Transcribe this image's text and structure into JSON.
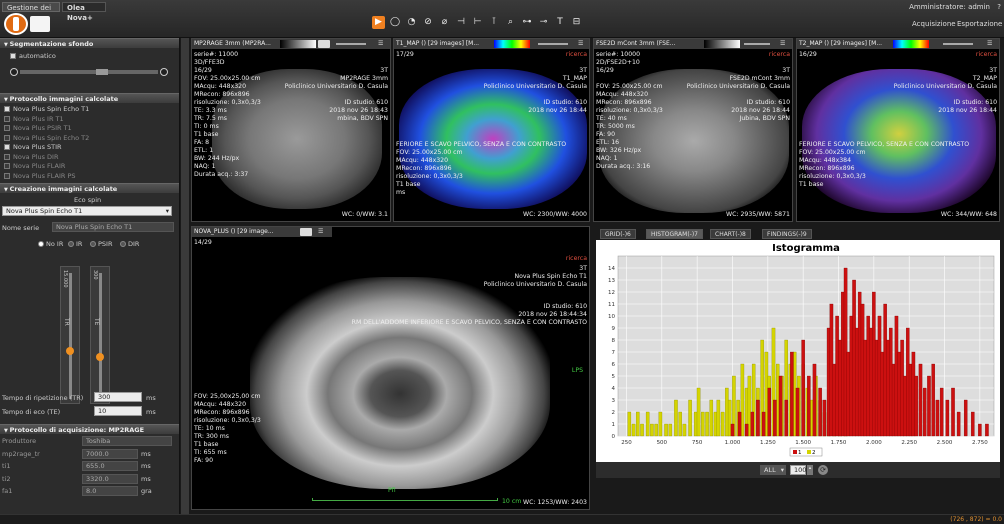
{
  "tabs": {
    "gestione": "Gestione dei dati",
    "olea": "Olea Nova+"
  },
  "top": {
    "admin": "Amministratore: admin",
    "help": "?",
    "nav": [
      "Acquisizione",
      "Esportazione"
    ]
  },
  "tools": [
    "▶",
    "◯",
    "◔",
    "⊘",
    "⌀",
    "⊣",
    "⊢",
    "⊺",
    "⌕",
    "⊶",
    "⊸",
    "T",
    "⊟"
  ],
  "left": {
    "seg_title": "Segmentazione sfondo",
    "automatico": "automatico",
    "proto_calc_title": "Protocollo immagini calcolate",
    "proto_items": [
      {
        "label": "Nova Plus Spin Echo T1",
        "checked": true
      },
      {
        "label": "Nova Plus IR T1",
        "checked": false
      },
      {
        "label": "Nova Plus PSIR T1",
        "checked": false
      },
      {
        "label": "Nova Plus Spin Echo T2",
        "checked": false
      },
      {
        "label": "Nova Plus STIR",
        "checked": true
      },
      {
        "label": "Nova Plus DIR",
        "checked": false
      },
      {
        "label": "Nova Plus FLAIR",
        "checked": false
      },
      {
        "label": "Nova Plus FLAIR PS",
        "checked": false
      }
    ],
    "creazione_title": "Creazione immagini calcolate",
    "eco_spin": "Eco spin",
    "select_value": "Nova Plus Spin Echo T1",
    "nome_serie_label": "Nome serie",
    "nome_serie_value": "Nova Plus Spin Echo T1",
    "radios": [
      "No IR",
      "IR",
      "PSIR",
      "DIR"
    ],
    "tr_label": "TR",
    "te_label": "TE",
    "tr_scale": [
      "15.000",
      "0",
      "",
      "300",
      "0"
    ],
    "tr_field_label": "Tempo di ripetizione (TR)",
    "tr_value": "300",
    "tr_unit": "ms",
    "te_field_label": "Tempo di eco (TE)",
    "te_value": "10",
    "te_unit": "ms",
    "acq_title": "Protocollo di acquisizione: MP2RAGE",
    "acq_rows": [
      {
        "label": "Produttore",
        "value": "Toshiba",
        "unit": ""
      },
      {
        "label": "mp2rage_tr",
        "value": "7000.0",
        "unit": "ms"
      },
      {
        "label": "ti1",
        "value": "655.0",
        "unit": "ms"
      },
      {
        "label": "ti2",
        "value": "3320.0",
        "unit": "ms"
      },
      {
        "label": "fa1",
        "value": "8.0",
        "unit": "gra"
      }
    ]
  },
  "vp1": {
    "title": "MP2RAGE 3mm (MP2RA...",
    "serie": "serie#: 11000",
    "seq": "3D/FFE3D",
    "slice": "16/29",
    "fov": "FOV: 25.00x25.00 cm",
    "macq": "MAcqu: 448x320",
    "mrecon": "MRecon: 896x896",
    "ris": "risoluzione: 0,3x0,3/3",
    "te": "TE: 3.3 ms",
    "tr": "TR: 7.5 ms",
    "ti": "TI: 0 ms",
    "t1": "T1 base",
    "fa": "FA: 8",
    "etl": "ETL: 1",
    "bw": "BW: 244 Hz/px",
    "naq": "NAQ: 1",
    "dur": "Durata acq.: 3:37",
    "tr_r1": "3T",
    "tr_r2": "MP2RAGE 3mm",
    "tr_r3": "Policlinico Universitario D. Casula",
    "id": "ID studio: 610",
    "date": "2018 nov 26 18:43",
    "body": "mbina, BDV SPN",
    "wc": "WC: 0/WW: 3.1"
  },
  "vp2": {
    "title": "T1_MAP () [29 images] [M...",
    "slice": "17/29",
    "ric": "ricerca",
    "r1": "3T",
    "r2": "T1_MAP",
    "r3": "Policlinico Universitario D. Casula",
    "id": "ID studio: 610",
    "date": "2018 nov 26 18:44",
    "desc": "FERIORE E SCAVO PELVICO, SENZA E CON CONTRASTO",
    "fov": "FOV: 25.00x25.00 cm",
    "macq": "MAcqu: 448x320",
    "mrecon": "MRecon: 896x896",
    "ris": "risoluzione: 0,3x0,3/3",
    "t1": "T1 base",
    "ms": "ms",
    "wc": "WC: 2300/WW: 4000",
    "ruler": "10 cm"
  },
  "vp3": {
    "title": "FSE2D mCont 3mm (FSE...",
    "serie": "serie#: 10000",
    "seq": "2D/FSE2D+10",
    "slice": "16/29",
    "ric": "ricerca",
    "r1": "3T",
    "r2": "FSE2D mCont 3mm",
    "r3": "Policlinico Universitario D. Casula",
    "id": "ID studio: 610",
    "date": "2018 nov 26 18:44",
    "fov": "FOV: 25.00x25.00 cm",
    "macq": "MAcqu: 448x320",
    "mrecon": "MRecon: 896x896",
    "ris": "risoluzione: 0,3x0,3/3",
    "te": "TE: 40 ms",
    "tr": "TR: 5000 ms",
    "fa": "FA: 90",
    "etl": "ETL: 16",
    "bw": "BW: 326 Hz/px",
    "naq": "NAQ: 1",
    "dur": "Durata acq.: 3:16",
    "body": "Jubina, BDV SPN",
    "desc": "FERIORE E SCAVO PELVICO, SENZA E CON CONTRASTO",
    "wc": "WC: 2935/WW: 5871"
  },
  "vp4": {
    "title": "T2_MAP () [29 images] [M...",
    "slice": "16/29",
    "ric": "ricerca",
    "r1": "3T",
    "r2": "T2_MAP",
    "r3": "Policlinico Universitario D. Casula",
    "id": "ID studio: 610",
    "date": "2018 nov 26 18:44",
    "desc": "FERIORE E SCAVO PELVICO, SENZA E CON CONTRASTO",
    "fov": "FOV: 25.00x25.00 cm",
    "macq": "MAcqu: 448x384",
    "mrecon": "MRecon: 896x896",
    "ris": "risoluzione: 0,3x0,3/3",
    "t1": "T1 base",
    "wc": "WC: 344/WW: 648"
  },
  "vp5": {
    "title": "NOVA_PLUS () [29 image...",
    "slice": "14/29",
    "ric": "ricerca",
    "r1": "3T",
    "r2": "Nova Plus Spin Echo T1",
    "r3": "Policlinico Universitario D. Casula",
    "id": "ID studio: 610",
    "date": "2018 nov 26 18:44:34",
    "desc": "RM DELL'ADDOME INFERIORE E SCAVO PELVICO, SENZA E CON CONTRASTO",
    "fov": "FOV: 25,00x25,00 cm",
    "macq": "MAcqu: 448x320",
    "mrecon": "MRecon: 896x896",
    "ris": "risoluzione: 0,3x0,3/3",
    "te": "TE: 10 ms",
    "tr": "TR: 300 ms",
    "t1": "T1 base",
    "ti": "TI: 655 ms",
    "fa": "FA: 90",
    "wc": "WC: 1253/WW: 2403",
    "ruler": "10 cm",
    "lps": "LPS",
    "pfi": "Pfi"
  },
  "rtabs": [
    "GRID(-)6",
    "HISTOGRAM(-)7",
    "CHART(-)8",
    "FINDINGS(-)9"
  ],
  "bottom": {
    "all": "ALL",
    "bins": "100"
  },
  "status": {
    "coords": "(726 , 872) = 0.0"
  },
  "chart_data": {
    "type": "bar",
    "title": "Istogramma",
    "xlim": [
      190,
      2850
    ],
    "ylim": [
      0,
      15
    ],
    "xticks": [
      250,
      500,
      750,
      1000,
      1250,
      1500,
      1750,
      2000,
      2250,
      2500,
      2750
    ],
    "xticklabels": [
      "250",
      "500",
      "750",
      "1.000",
      "1.250",
      "1.500",
      "1.750",
      "2.000",
      "2.250",
      "2.500",
      "2.750"
    ],
    "yticks": [
      0,
      1,
      2,
      3,
      4,
      5,
      6,
      7,
      8,
      9,
      10,
      11,
      12,
      13,
      14
    ],
    "legend": [
      "1",
      "2"
    ],
    "series": [
      {
        "color": "#d4d400",
        "x": [
          270,
          300,
          330,
          360,
          400,
          430,
          460,
          490,
          530,
          560,
          600,
          630,
          660,
          700,
          740,
          760,
          790,
          820,
          850,
          880,
          900,
          930,
          960,
          980,
          1010,
          1040,
          1070,
          1100,
          1120,
          1150,
          1180,
          1210,
          1240,
          1260,
          1290,
          1320,
          1350,
          1380,
          1410,
          1440,
          1470,
          1500,
          1530,
          1560,
          1590,
          1620,
          1650,
          1680,
          1720,
          1760,
          1800
        ],
        "values": [
          2,
          1,
          2,
          1,
          2,
          1,
          1,
          2,
          1,
          1,
          3,
          2,
          1,
          3,
          2,
          4,
          2,
          2,
          3,
          2,
          3,
          2,
          4,
          3,
          5,
          3,
          6,
          4,
          5,
          6,
          4,
          8,
          7,
          5,
          9,
          6,
          5,
          8,
          6,
          7,
          5,
          6,
          4,
          3,
          5,
          3,
          2,
          3,
          2,
          2,
          1
        ]
      },
      {
        "color": "#cc1010",
        "x": [
          1000,
          1050,
          1100,
          1140,
          1180,
          1220,
          1260,
          1300,
          1340,
          1380,
          1420,
          1460,
          1500,
          1540,
          1580,
          1620,
          1650,
          1680,
          1700,
          1720,
          1740,
          1760,
          1780,
          1800,
          1820,
          1840,
          1860,
          1880,
          1900,
          1920,
          1940,
          1960,
          1980,
          2000,
          2020,
          2040,
          2060,
          2080,
          2100,
          2120,
          2140,
          2160,
          2180,
          2200,
          2220,
          2240,
          2260,
          2280,
          2300,
          2330,
          2360,
          2390,
          2420,
          2450,
          2480,
          2520,
          2560,
          2600,
          2650,
          2700,
          2750,
          2800
        ],
        "values": [
          1,
          2,
          1,
          2,
          3,
          2,
          4,
          3,
          5,
          3,
          7,
          4,
          8,
          5,
          6,
          4,
          3,
          9,
          11,
          6,
          10,
          8,
          12,
          14,
          7,
          10,
          13,
          9,
          12,
          11,
          8,
          10,
          9,
          12,
          8,
          10,
          7,
          11,
          8,
          9,
          6,
          10,
          7,
          8,
          5,
          9,
          6,
          7,
          5,
          6,
          4,
          5,
          6,
          3,
          4,
          3,
          4,
          2,
          3,
          2,
          1,
          1
        ]
      }
    ]
  }
}
